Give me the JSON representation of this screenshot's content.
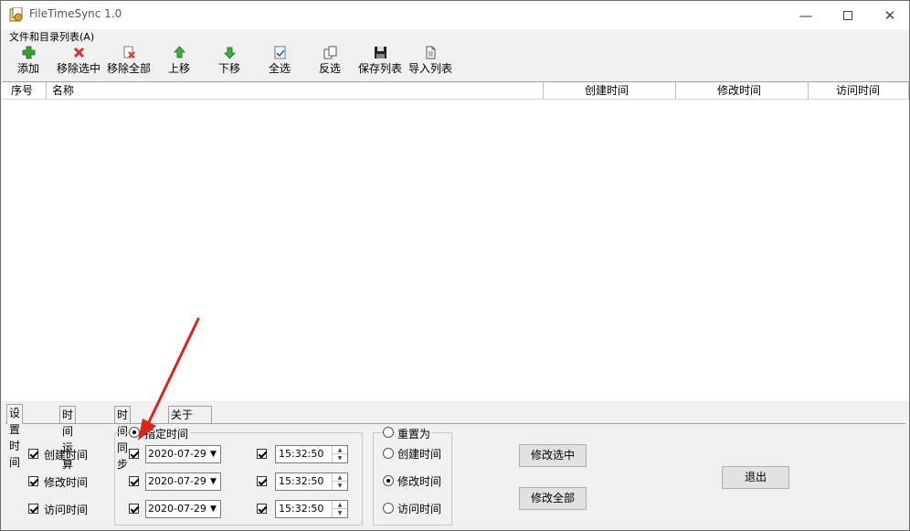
{
  "window": {
    "title": "FileTimeSync 1.0",
    "minimize": "—",
    "close": "✕"
  },
  "filelist": {
    "group_label": "文件和目录列表(A)",
    "toolbar": [
      {
        "label": "添加",
        "icon": "add-icon"
      },
      {
        "label": "移除选中",
        "icon": "remove-selected-icon"
      },
      {
        "label": "移除全部",
        "icon": "remove-all-icon"
      },
      {
        "label": "上移",
        "icon": "move-up-icon"
      },
      {
        "label": "下移",
        "icon": "move-down-icon"
      },
      {
        "label": "全选",
        "icon": "select-all-icon"
      },
      {
        "label": "反选",
        "icon": "invert-selection-icon"
      },
      {
        "label": "保存列表",
        "icon": "save-list-icon"
      },
      {
        "label": "导入列表",
        "icon": "import-list-icon"
      }
    ],
    "columns": [
      "序号",
      "名称",
      "创建时间",
      "修改时间",
      "访问时间"
    ]
  },
  "tabs": [
    "设置时间",
    "时间运算",
    "时间同步",
    "关于"
  ],
  "active_tab": "设置时间",
  "set_time": {
    "targets": [
      {
        "label": "创建时间",
        "checked": true
      },
      {
        "label": "修改时间",
        "checked": true
      },
      {
        "label": "访问时间",
        "checked": true
      }
    ],
    "specify_group": {
      "title": "指定时间",
      "selected": true,
      "rows": [
        {
          "date_checked": true,
          "date": "2020-07-29",
          "time_checked": true,
          "time": "15:32:50"
        },
        {
          "date_checked": true,
          "date": "2020-07-29",
          "time_checked": true,
          "time": "15:32:50"
        },
        {
          "date_checked": true,
          "date": "2020-07-29",
          "time_checked": true,
          "time": "15:32:50"
        }
      ]
    },
    "reset_group": {
      "title": "重置为",
      "options": [
        {
          "label": "创建时间",
          "selected": false
        },
        {
          "label": "修改时间",
          "selected": true
        },
        {
          "label": "访问时间",
          "selected": false
        }
      ]
    },
    "buttons": {
      "modify_selected": "修改选中",
      "modify_all": "修改全部",
      "exit": "退出"
    }
  },
  "colors": {
    "annotation_arrow": "#d9241c",
    "accent_green": "#2ea52e",
    "accent_red": "#d83030"
  }
}
